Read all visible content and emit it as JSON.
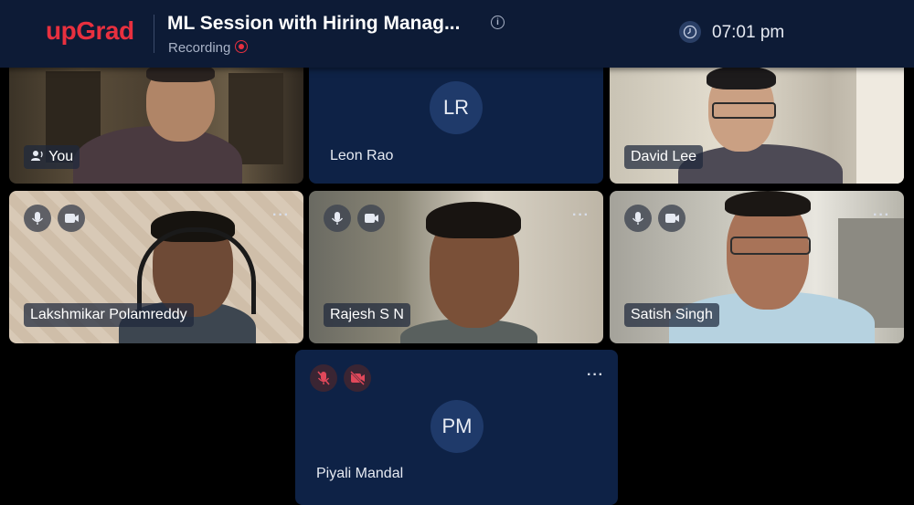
{
  "header": {
    "logo": "upGrad",
    "title": "ML Session with Hiring Manag...",
    "recording_label": "Recording",
    "time": "07:01 pm"
  },
  "participants": [
    {
      "name": "You",
      "video": true
    },
    {
      "name": "Leon Rao",
      "initials": "LR",
      "video": false
    },
    {
      "name": "David Lee",
      "video": true
    },
    {
      "name": "Lakshmikar Polamreddy",
      "video": true
    },
    {
      "name": "Rajesh S N",
      "video": true
    },
    {
      "name": "Satish Singh",
      "video": true
    },
    {
      "name": "Piyali Mandal",
      "initials": "PM",
      "video": false,
      "muted": true,
      "camera_off": true
    }
  ],
  "more_options_glyph": "···",
  "colors": {
    "header_bg": "#0d1b36",
    "brand": "#e8303f",
    "tile_navy": "#0e2246"
  }
}
